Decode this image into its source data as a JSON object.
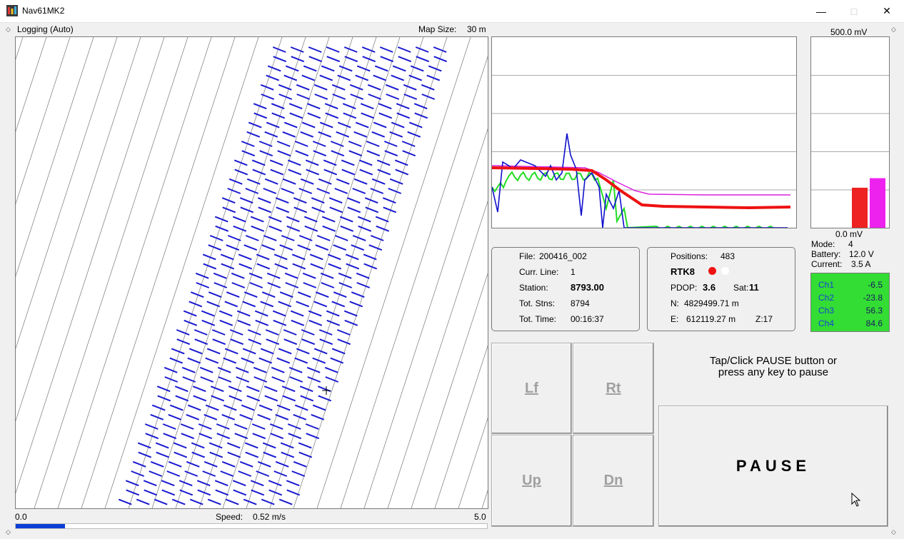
{
  "window": {
    "title": "Nav61MK2",
    "minimize_icon": "minimize-icon",
    "maximize_icon": "maximize-icon",
    "close_icon": "close-icon"
  },
  "header": {
    "mode_label": "Logging (Auto)",
    "map_size_label": "Map Size:",
    "map_size_value": "30 m"
  },
  "speed": {
    "min": "0.0",
    "max": "5.0",
    "label": "Speed:",
    "value": "0.52 m/s",
    "fraction": 0.104
  },
  "signal": {
    "top_label": "500.0 mV",
    "bottom_label": "0.0 mV",
    "bar_colors": [
      "#ee2222",
      "#ee22ee"
    ],
    "bar_levels": [
      0.21,
      0.26
    ]
  },
  "status": {
    "mode_label": "Mode:",
    "mode_value": "4",
    "battery_label": "Battery:",
    "battery_value": "12.0 V",
    "current_label": "Current:",
    "current_value": "3.5 A"
  },
  "file_panel": {
    "file_label": "File:",
    "file_value": "200416_002",
    "line_label": "Curr. Line:",
    "line_value": "1",
    "station_label": "Station:",
    "station_value": "8793.00",
    "stns_label": "Tot. Stns:",
    "stns_value": "8794",
    "time_label": "Tot. Time:",
    "time_value": "00:16:37"
  },
  "gps_panel": {
    "positions_label": "Positions:",
    "positions_value": "483",
    "fix_label": "RTK8",
    "fix_indicator_colors": [
      "#ee1111",
      "#ffffff"
    ],
    "pdop_label": "PDOP:",
    "pdop_value": "3.6",
    "sat_label": "Sat:",
    "sat_value": "11",
    "north_label": "N:",
    "north_value": "4829499.71 m",
    "east_label": "E:",
    "east_value": "612119.27 m",
    "zone_label": "Z:17"
  },
  "channels": [
    {
      "name": "Ch1",
      "value": "-6.5"
    },
    {
      "name": "Ch2",
      "value": "-23.8"
    },
    {
      "name": "Ch3",
      "value": "56.3"
    },
    {
      "name": "Ch4",
      "value": "84.6"
    }
  ],
  "buttons": {
    "left": "Lf",
    "right": "Rt",
    "up": "Up",
    "down": "Dn",
    "pause": "PAUSE"
  },
  "message": {
    "line1": "Tap/Click PAUSE button or",
    "line2": "press any key to pause"
  },
  "colors": {
    "track": "#1a1ad0",
    "trace_blue": "#1010cc",
    "trace_red": "#ee1111",
    "trace_magenta": "#dd22dd",
    "trace_green": "#22dd22",
    "channel_bg": "#33dd33"
  }
}
